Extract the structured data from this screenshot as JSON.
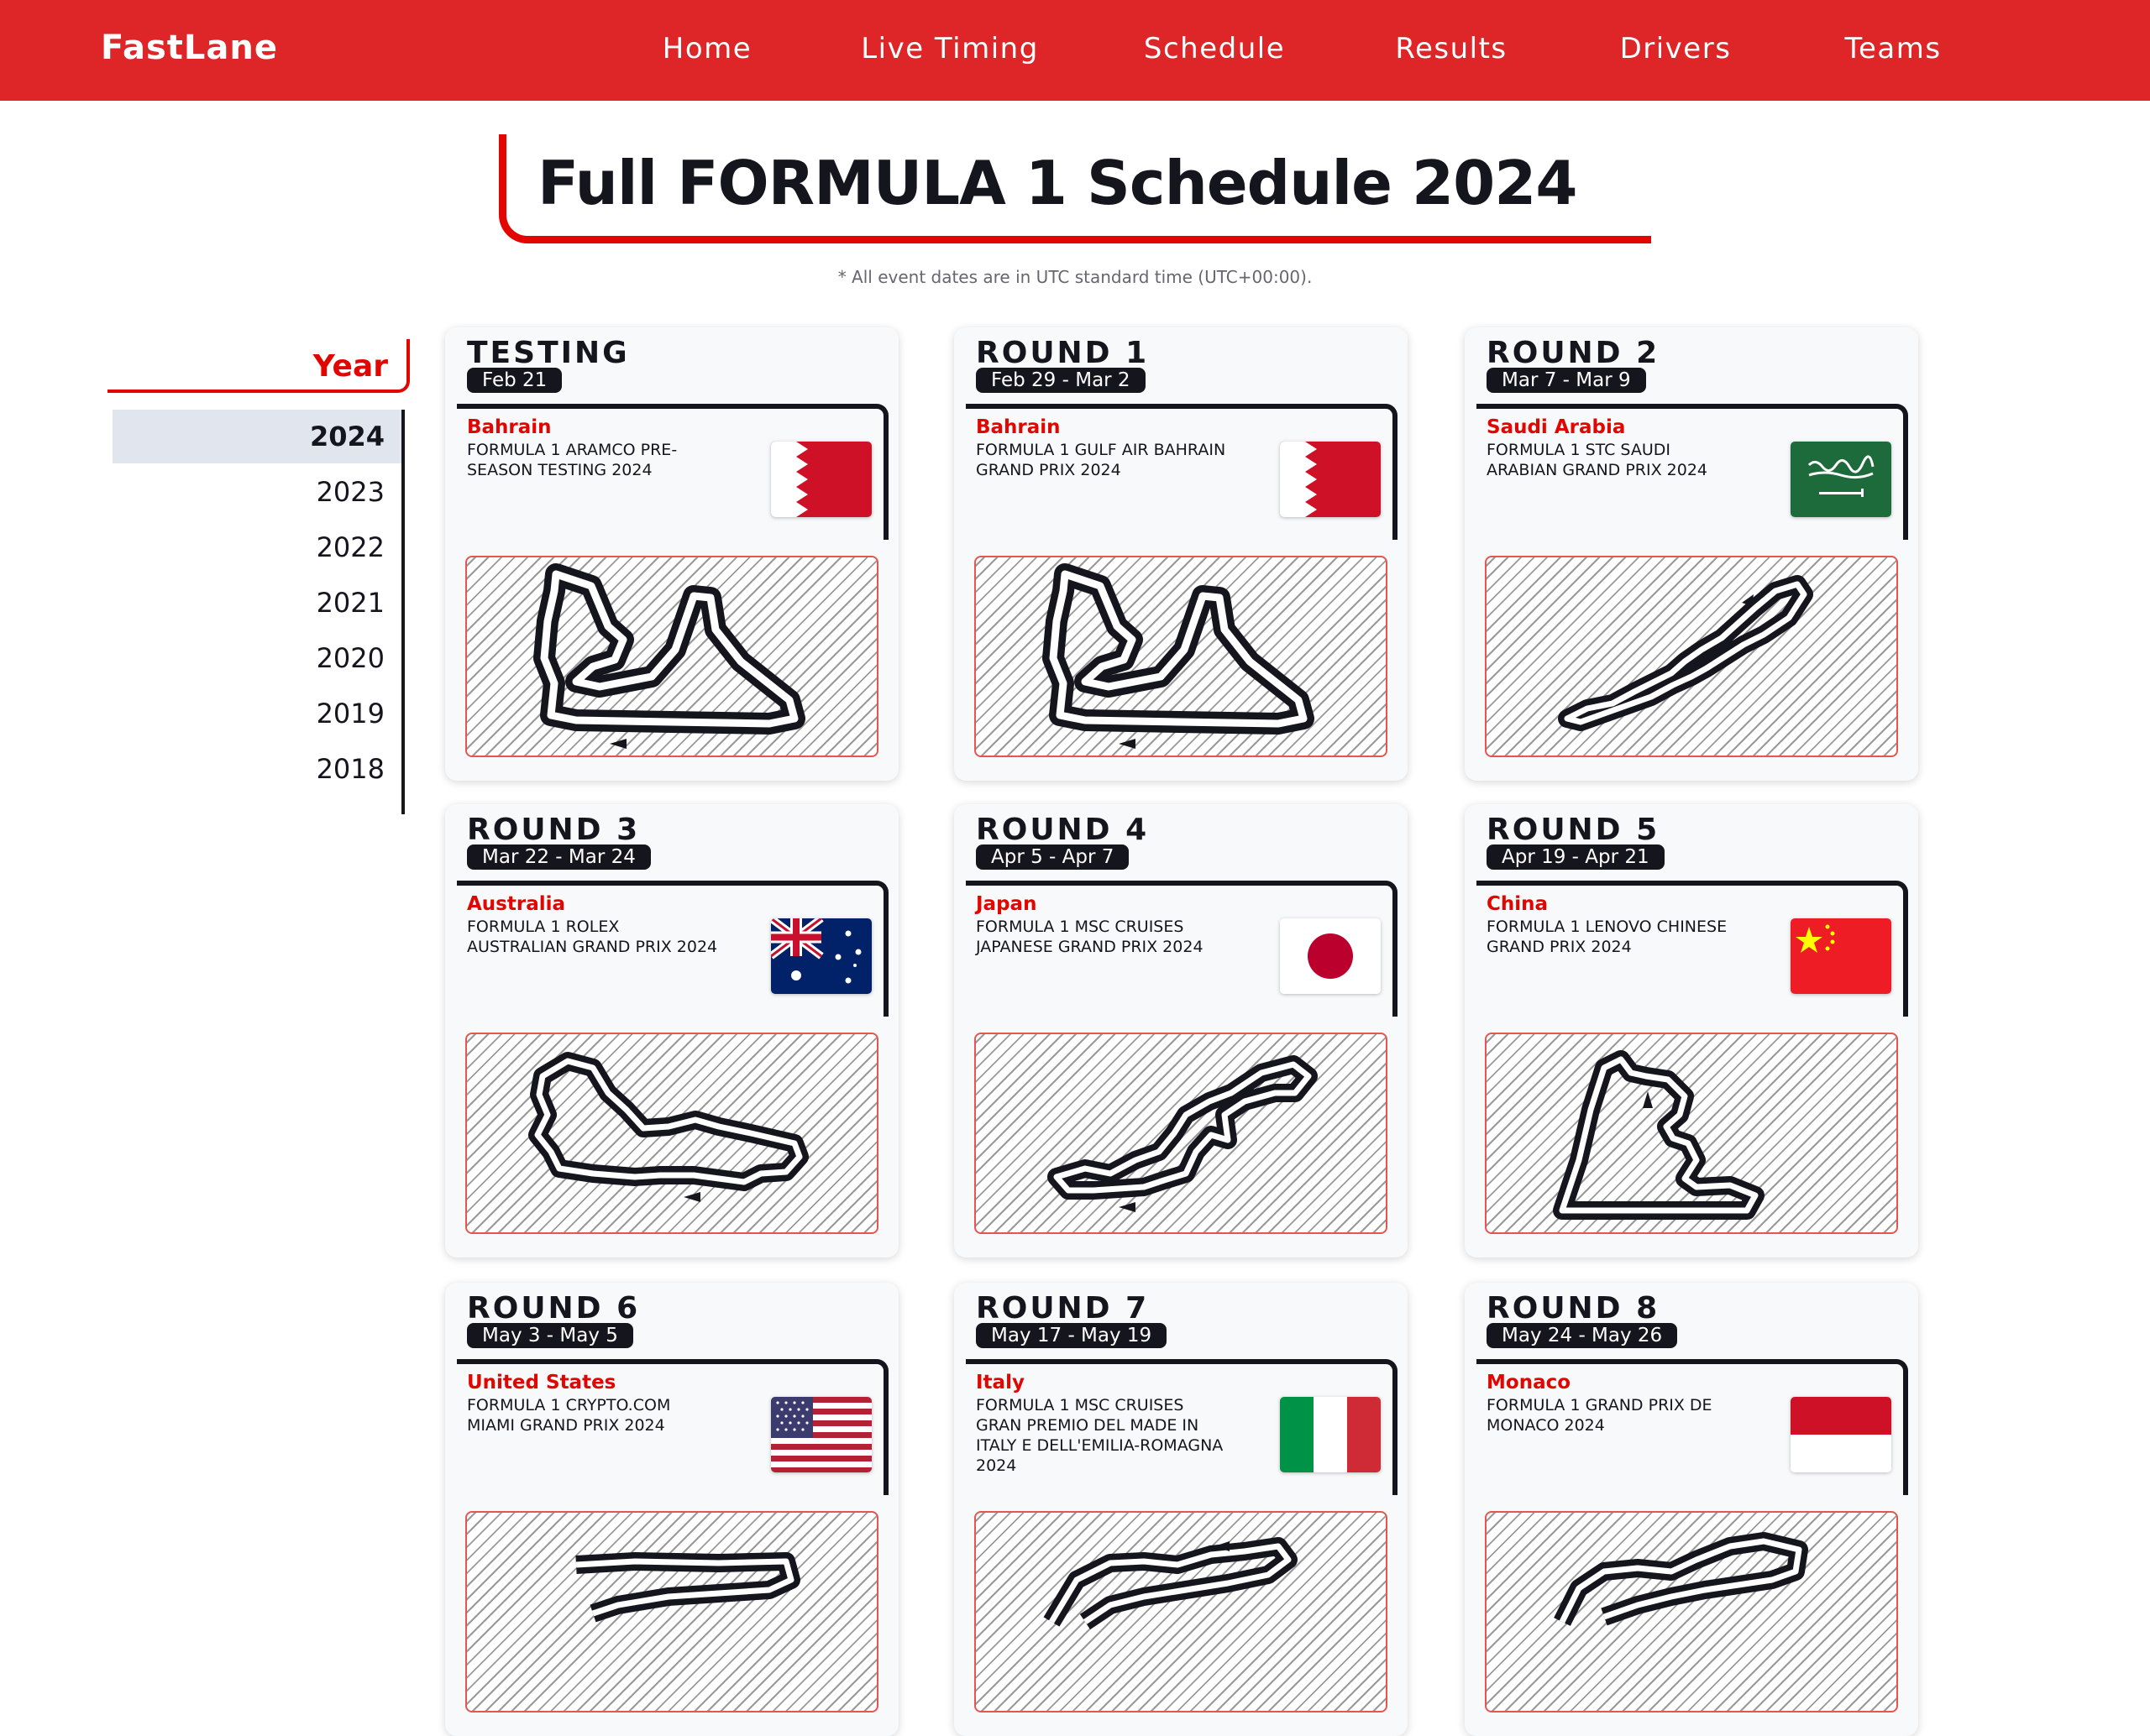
{
  "nav": {
    "logo": "FastLane",
    "links": [
      "Home",
      "Live Timing",
      "Schedule",
      "Results",
      "Drivers",
      "Teams"
    ]
  },
  "page": {
    "title": "Full FORMULA 1 Schedule 2024",
    "subtitle": "* All event dates are in UTC standard time (UTC+00:00)."
  },
  "years": {
    "label": "Year",
    "items": [
      "2024",
      "2023",
      "2022",
      "2021",
      "2020",
      "2019",
      "2018"
    ],
    "selected": "2024"
  },
  "events": [
    {
      "round": "TESTING",
      "dates": "Feb 21",
      "country": "Bahrain",
      "name": "FORMULA 1 ARAMCO PRE-SEASON TESTING 2024",
      "flag": "bahrain-flag",
      "track": "bahrain-circuit"
    },
    {
      "round": "ROUND 1",
      "dates": "Feb 29 - Mar 2",
      "country": "Bahrain",
      "name": "FORMULA 1 GULF AIR BAHRAIN GRAND PRIX 2024",
      "flag": "bahrain-flag",
      "track": "bahrain-circuit"
    },
    {
      "round": "ROUND 2",
      "dates": "Mar 7 - Mar 9",
      "country": "Saudi Arabia",
      "name": "FORMULA 1 STC SAUDI ARABIAN GRAND PRIX 2024",
      "flag": "saudi-arabia-flag",
      "track": "jeddah-circuit"
    },
    {
      "round": "ROUND 3",
      "dates": "Mar 22 - Mar 24",
      "country": "Australia",
      "name": "FORMULA 1 ROLEX AUSTRALIAN GRAND PRIX 2024",
      "flag": "australia-flag",
      "track": "albert-park-circuit"
    },
    {
      "round": "ROUND 4",
      "dates": "Apr 5 - Apr 7",
      "country": "Japan",
      "name": "FORMULA 1 MSC CRUISES JAPANESE GRAND PRIX 2024",
      "flag": "japan-flag",
      "track": "suzuka-circuit"
    },
    {
      "round": "ROUND 5",
      "dates": "Apr 19 - Apr 21",
      "country": "China",
      "name": "FORMULA 1 LENOVO CHINESE GRAND PRIX 2024",
      "flag": "china-flag",
      "track": "shanghai-circuit"
    },
    {
      "round": "ROUND 6",
      "dates": "May 3 - May 5",
      "country": "United States",
      "name": "FORMULA 1 CRYPTO.COM MIAMI GRAND PRIX 2024",
      "flag": "united-states-flag",
      "track": "miami-circuit"
    },
    {
      "round": "ROUND 7",
      "dates": "May 17 - May 19",
      "country": "Italy",
      "name": "FORMULA 1 MSC CRUISES GRAN PREMIO DEL MADE IN ITALY E DELL'EMILIA-ROMAGNA 2024",
      "flag": "italy-flag",
      "track": "imola-circuit"
    },
    {
      "round": "ROUND 8",
      "dates": "May 24 - May 26",
      "country": "Monaco",
      "name": "FORMULA 1 GRAND PRIX DE MONACO 2024",
      "flag": "monaco-flag",
      "track": "monaco-circuit"
    }
  ],
  "colors": {
    "brand_red": "#de2528",
    "accent_red": "#e10600",
    "dark": "#15151e",
    "selected_year_bg": "#e0e5ee"
  }
}
